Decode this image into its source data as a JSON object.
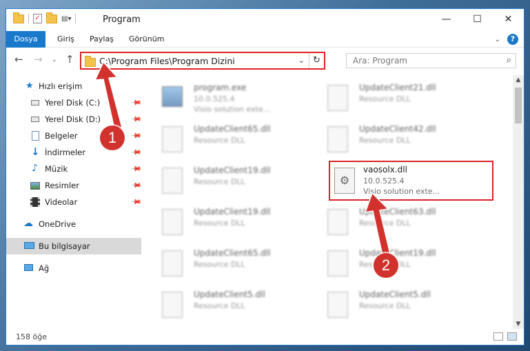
{
  "window": {
    "title": "Program"
  },
  "ribbon": {
    "tabs": [
      "Dosya",
      "Giriş",
      "Paylaş",
      "Görünüm"
    ],
    "help": "?"
  },
  "address": {
    "path": "C:\\Program Files\\Program Dizini"
  },
  "search": {
    "placeholder": "Ara: Program"
  },
  "sidebar": {
    "quick_access": "Hızlı erişim",
    "items": [
      {
        "label": "Yerel Disk (C:)",
        "icon": "drive-icon"
      },
      {
        "label": "Yerel Disk (D:)",
        "icon": "drive-icon"
      },
      {
        "label": "Belgeler",
        "icon": "documents-icon"
      },
      {
        "label": "İndirmeler",
        "icon": "download-icon"
      },
      {
        "label": "Müzik",
        "icon": "music-icon"
      },
      {
        "label": "Resimler",
        "icon": "pictures-icon"
      },
      {
        "label": "Videolar",
        "icon": "video-icon"
      }
    ],
    "onedrive": "OneDrive",
    "this_pc": "Bu bilgisayar",
    "network": "Ağ"
  },
  "files": [
    {
      "name": "program.exe",
      "line2": "10.0.525.4",
      "line3": "Visio solution exte..."
    },
    {
      "name": "UpdateClient21.dll",
      "line2": "Resource DLL"
    },
    {
      "name": "UpdateClient65.dll",
      "line2": "Resource DLL"
    },
    {
      "name": "UpdateClient42.dll",
      "line2": "Resource DLL"
    },
    {
      "name": "UpdateClient19.dll",
      "line2": "Resource DLL"
    },
    {
      "name": "vaosolx.dll",
      "line2": "10.0.525.4",
      "line3": "Visio solution exte..."
    },
    {
      "name": "UpdateClient19.dll",
      "line2": "Resource DLL"
    },
    {
      "name": "UpdateClient63.dll",
      "line2": "Resource DLL"
    },
    {
      "name": "UpdateClient65.dll",
      "line2": "Resource DLL"
    },
    {
      "name": "UpdateClient19.dll",
      "line2": "Resource DLL"
    },
    {
      "name": "UpdateClient5.dll",
      "line2": "Resource DLL"
    },
    {
      "name": "UpdateClient5.dll",
      "line2": "Resource DLL"
    }
  ],
  "status": {
    "count": "158 öğe"
  },
  "markers": [
    "1",
    "2"
  ],
  "colors": {
    "accent": "#1979ca",
    "highlight": "#dd2222",
    "badge": "#d2322d"
  }
}
